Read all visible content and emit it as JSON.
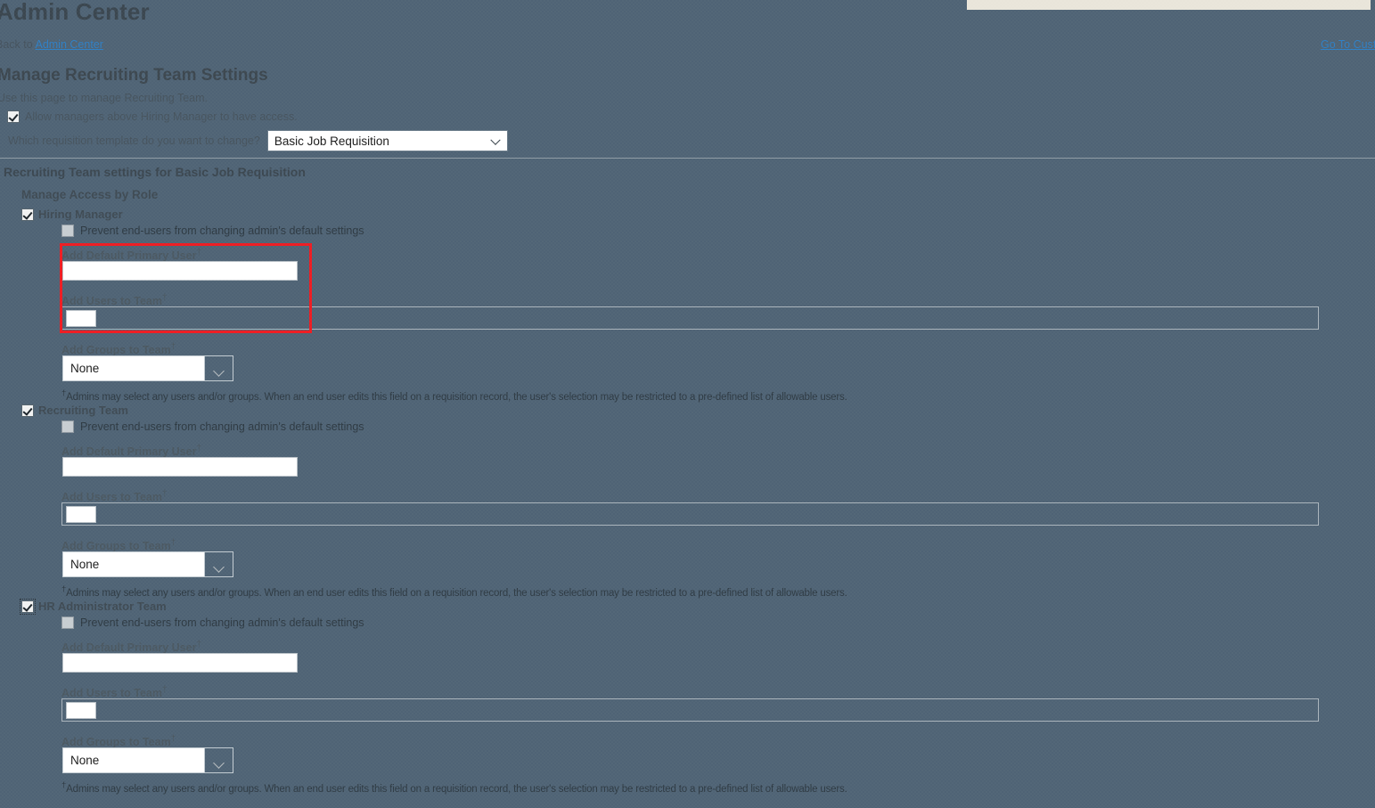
{
  "header": {
    "app_title": "Admin Center",
    "back_prefix": "Back to",
    "back_link": "Admin Center",
    "goto_link": "Go To Customize Application Security",
    "page_title": "Manage Recruiting Team Settings",
    "page_subtitle": "Use this page to manage Recruiting Team."
  },
  "options": {
    "allow_managers_label": "Allow managers above Hiring Manager to have access.",
    "allow_managers_checked": true,
    "template_question": "Which requisition template do you want to change?",
    "template_selected": "Basic Job Requisition",
    "template_options": [
      "Basic Job Requisition"
    ],
    "chevron_icon": "chevron-down-icon"
  },
  "section": {
    "title": "Recruiting Team settings for Basic Job Requisition",
    "subtitle": "Manage Access by Role"
  },
  "field_labels": {
    "prevent": "Prevent end-users from changing admin's default settings",
    "default_primary_user": "Add Default Primary User",
    "users_to_team": "Add Users to Team",
    "groups_to_team": "Add Groups to Team",
    "dagger": "†"
  },
  "footnote_text": "Admins may select any users and/or groups. When an end user edits this field on a requisition record, the user's selection may be restricted to a pre-defined list of allowable users.",
  "roles": [
    {
      "name": "Hiring Manager",
      "enabled_checked": true,
      "focused": false,
      "prevent_checked": false,
      "default_primary_user_value": "",
      "users_to_team_value": "",
      "groups_to_team_value": "None",
      "groups_options": [
        "None"
      ]
    },
    {
      "name": "Recruiting Team",
      "enabled_checked": true,
      "focused": false,
      "prevent_checked": false,
      "default_primary_user_value": "",
      "users_to_team_value": "",
      "groups_to_team_value": "None",
      "groups_options": [
        "None"
      ]
    },
    {
      "name": "HR Administrator Team",
      "enabled_checked": true,
      "focused": true,
      "prevent_checked": false,
      "default_primary_user_value": "",
      "users_to_team_value": "",
      "groups_to_team_value": "None",
      "groups_options": [
        "None"
      ]
    }
  ],
  "annotation": {
    "color": "#ee1c22",
    "name": "highlight-rectangle"
  },
  "colors": {
    "page_background": "#4f6375",
    "accent_link": "#2f7fc4",
    "top_strip": "#e9e5da",
    "annotation_red": "#ee1c22"
  }
}
